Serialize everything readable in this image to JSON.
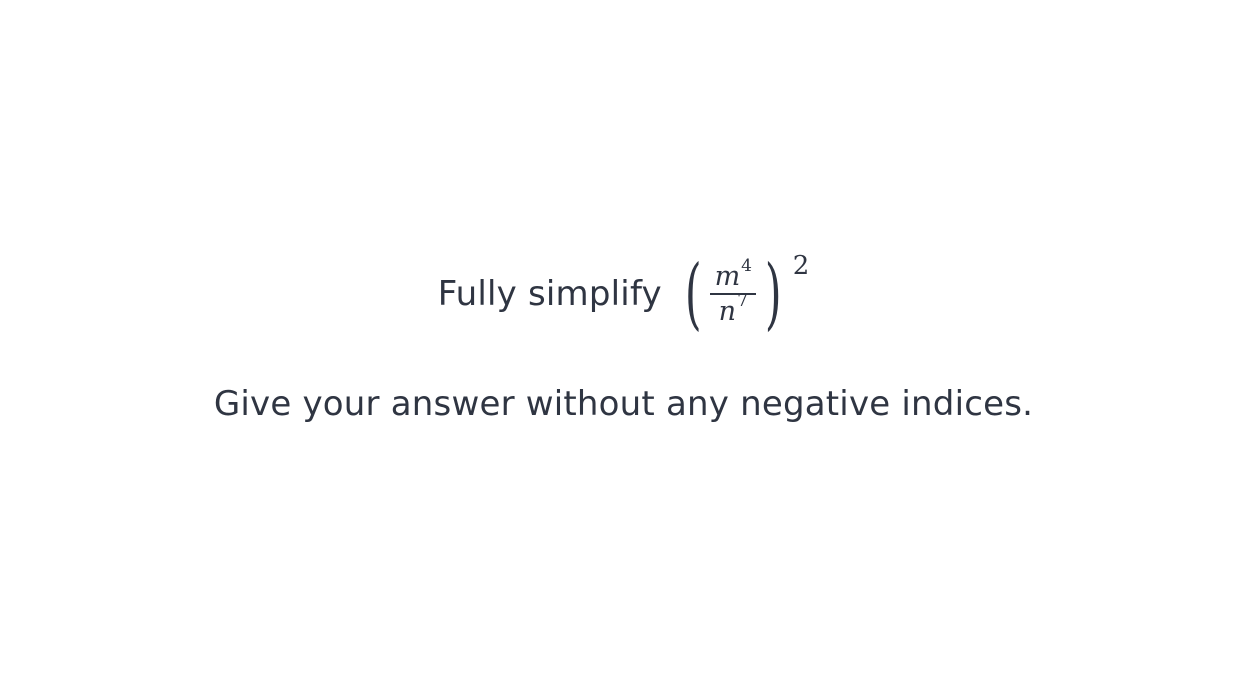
{
  "question": {
    "prompt": "Fully simplify",
    "expression": {
      "open_paren": "(",
      "numerator_base": "m",
      "numerator_exponent": "4",
      "denominator_base": "n",
      "denominator_exponent": "7",
      "close_paren": ")",
      "outer_exponent": "2"
    }
  },
  "instruction": "Give your answer without any negative indices."
}
